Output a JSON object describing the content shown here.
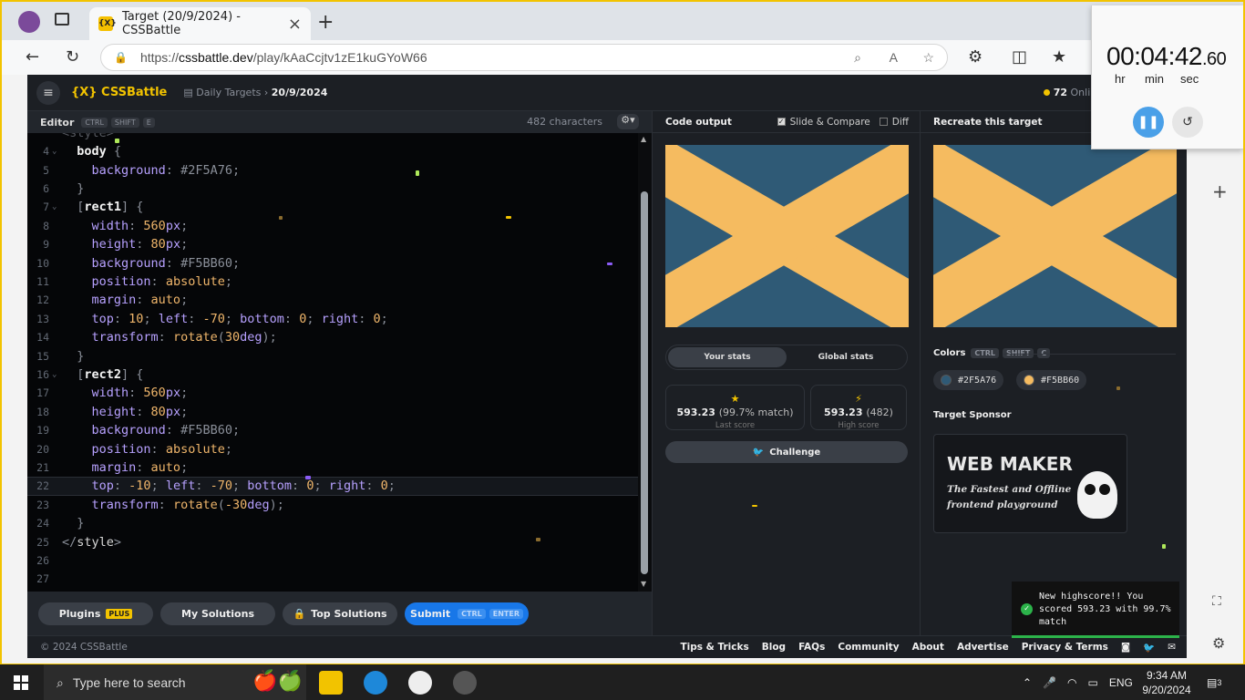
{
  "browser": {
    "tab_title": "Target (20/9/2024) - CSSBattle",
    "url_prefix": "https://",
    "url_host": "cssbattle.dev",
    "url_path": "/play/kAaCcjtv1zE1kuGYoW66"
  },
  "app": {
    "logo": "{X} CSSBattle",
    "breadcrumb_section": "Daily Targets",
    "breadcrumb_current": "20/9/2024",
    "online_count": "72",
    "online_label": "Online"
  },
  "editor": {
    "title": "Editor",
    "shortcut": [
      "CTRL",
      "SHIFT",
      "E"
    ],
    "char_count": "482 characters",
    "lines": [
      {
        "n": "4",
        "fold": true,
        "parts": [
          [
            "sel",
            "  body "
          ],
          [
            "pun",
            "{"
          ]
        ]
      },
      {
        "n": "5",
        "parts": [
          [
            "prop",
            "    background"
          ],
          [
            "pun",
            ": "
          ],
          [
            "pun",
            "#2F5A76"
          ],
          [
            "pun",
            ";"
          ]
        ]
      },
      {
        "n": "6",
        "parts": [
          [
            "pun",
            "  }"
          ]
        ]
      },
      {
        "n": "7",
        "fold": true,
        "parts": [
          [
            "pun",
            "  ["
          ],
          [
            "sel",
            "rect1"
          ],
          [
            "pun",
            "] {"
          ]
        ]
      },
      {
        "n": "8",
        "parts": [
          [
            "prop",
            "    width"
          ],
          [
            "pun",
            ": "
          ],
          [
            "val",
            "560"
          ],
          [
            "prop",
            "px"
          ],
          [
            "pun",
            ";"
          ]
        ]
      },
      {
        "n": "9",
        "parts": [
          [
            "prop",
            "    height"
          ],
          [
            "pun",
            ": "
          ],
          [
            "val",
            "80"
          ],
          [
            "prop",
            "px"
          ],
          [
            "pun",
            ";"
          ]
        ]
      },
      {
        "n": "10",
        "parts": [
          [
            "prop",
            "    background"
          ],
          [
            "pun",
            ": "
          ],
          [
            "pun",
            "#F5BB60"
          ],
          [
            "pun",
            ";"
          ]
        ]
      },
      {
        "n": "11",
        "parts": [
          [
            "prop",
            "    position"
          ],
          [
            "pun",
            ": "
          ],
          [
            "val",
            "absolute"
          ],
          [
            "pun",
            ";"
          ]
        ]
      },
      {
        "n": "12",
        "parts": [
          [
            "prop",
            "    margin"
          ],
          [
            "pun",
            ": "
          ],
          [
            "val",
            "auto"
          ],
          [
            "pun",
            ";"
          ]
        ]
      },
      {
        "n": "13",
        "parts": [
          [
            "prop",
            "    top"
          ],
          [
            "pun",
            ": "
          ],
          [
            "val",
            "10"
          ],
          [
            "pun",
            "; "
          ],
          [
            "prop",
            "left"
          ],
          [
            "pun",
            ": "
          ],
          [
            "val",
            "-70"
          ],
          [
            "pun",
            "; "
          ],
          [
            "prop",
            "bottom"
          ],
          [
            "pun",
            ": "
          ],
          [
            "val",
            "0"
          ],
          [
            "pun",
            "; "
          ],
          [
            "prop",
            "right"
          ],
          [
            "pun",
            ": "
          ],
          [
            "val",
            "0"
          ],
          [
            "pun",
            ";"
          ]
        ]
      },
      {
        "n": "14",
        "parts": [
          [
            "prop",
            "    transform"
          ],
          [
            "pun",
            ": "
          ],
          [
            "val",
            "rotate"
          ],
          [
            "pun",
            "("
          ],
          [
            "val",
            "30"
          ],
          [
            "prop",
            "deg"
          ],
          [
            "pun",
            ");"
          ]
        ]
      },
      {
        "n": "15",
        "parts": [
          [
            "pun",
            "  }"
          ]
        ]
      },
      {
        "n": "16",
        "fold": true,
        "parts": [
          [
            "pun",
            "  ["
          ],
          [
            "sel",
            "rect2"
          ],
          [
            "pun",
            "] {"
          ]
        ]
      },
      {
        "n": "17",
        "parts": [
          [
            "prop",
            "    width"
          ],
          [
            "pun",
            ": "
          ],
          [
            "val",
            "560"
          ],
          [
            "prop",
            "px"
          ],
          [
            "pun",
            ";"
          ]
        ]
      },
      {
        "n": "18",
        "parts": [
          [
            "prop",
            "    height"
          ],
          [
            "pun",
            ": "
          ],
          [
            "val",
            "80"
          ],
          [
            "prop",
            "px"
          ],
          [
            "pun",
            ";"
          ]
        ]
      },
      {
        "n": "19",
        "parts": [
          [
            "prop",
            "    background"
          ],
          [
            "pun",
            ": "
          ],
          [
            "pun",
            "#F5BB60"
          ],
          [
            "pun",
            ";"
          ]
        ]
      },
      {
        "n": "20",
        "parts": [
          [
            "prop",
            "    position"
          ],
          [
            "pun",
            ": "
          ],
          [
            "val",
            "absolute"
          ],
          [
            "pun",
            ";"
          ]
        ]
      },
      {
        "n": "21",
        "parts": [
          [
            "prop",
            "    margin"
          ],
          [
            "pun",
            ": "
          ],
          [
            "val",
            "auto"
          ],
          [
            "pun",
            ";"
          ]
        ]
      },
      {
        "n": "22",
        "active": true,
        "parts": [
          [
            "prop",
            "    top"
          ],
          [
            "pun",
            ": "
          ],
          [
            "val",
            "-10"
          ],
          [
            "pun",
            "; "
          ],
          [
            "prop",
            "left"
          ],
          [
            "pun",
            ": "
          ],
          [
            "val",
            "-70"
          ],
          [
            "pun",
            "; "
          ],
          [
            "prop",
            "bottom"
          ],
          [
            "pun",
            ": "
          ],
          [
            "val",
            "0"
          ],
          [
            "pun",
            "; "
          ],
          [
            "prop",
            "right"
          ],
          [
            "pun",
            ": "
          ],
          [
            "val",
            "0"
          ],
          [
            "pun",
            ";"
          ]
        ]
      },
      {
        "n": "23",
        "parts": [
          [
            "prop",
            "    transform"
          ],
          [
            "pun",
            ": "
          ],
          [
            "val",
            "rotate"
          ],
          [
            "pun",
            "("
          ],
          [
            "val",
            "-30"
          ],
          [
            "prop",
            "deg"
          ],
          [
            "pun",
            ");"
          ]
        ]
      },
      {
        "n": "24",
        "parts": [
          [
            "pun",
            "  }"
          ]
        ]
      },
      {
        "n": "25",
        "parts": [
          [
            "pun",
            "</"
          ],
          [
            "tag",
            "style"
          ],
          [
            "pun",
            ">"
          ]
        ]
      },
      {
        "n": "26",
        "parts": []
      },
      {
        "n": "27",
        "parts": []
      }
    ],
    "buttons": {
      "plugins": "Plugins",
      "plugins_badge": "PLUS",
      "my_solutions": "My Solutions",
      "top_solutions": "Top Solutions",
      "submit": "Submit",
      "submit_kbd": [
        "CTRL",
        "ENTER"
      ]
    }
  },
  "output": {
    "title": "Code output",
    "slide_compare": "Slide & Compare",
    "diff": "Diff",
    "tabs": [
      "Your stats",
      "Global stats"
    ],
    "last_score": "593.23",
    "last_match": "(99.7% match)",
    "last_label": "Last score",
    "high_score": "593.23",
    "high_chars": "(482)",
    "high_label": "High score",
    "challenge": "Challenge"
  },
  "target": {
    "title": "Recreate this target",
    "colors_label": "Colors",
    "colors_kbd": [
      "CTRL",
      "SHIFT",
      "C"
    ],
    "colors": [
      {
        "hex": "#2F5A76"
      },
      {
        "hex": "#F5BB60"
      }
    ],
    "sponsor_label": "Target Sponsor",
    "sponsor_name": "WEB MAKER",
    "sponsor_tag1": "The Fastest and Offline",
    "sponsor_tag2": "frontend playground"
  },
  "footer": {
    "copyright": "© 2024 CSSBattle",
    "links": [
      "Tips & Tricks",
      "Blog",
      "FAQs",
      "Community",
      "About",
      "Advertise",
      "Privacy & Terms"
    ]
  },
  "timer": {
    "main": "00:04:42",
    "fraction": ".60",
    "labels": [
      "hr",
      "min",
      "sec"
    ]
  },
  "toast": {
    "message": "New highscore!! You scored 593.23 with 99.7% match"
  },
  "taskbar": {
    "search_placeholder": "Type here to search",
    "language": "ENG",
    "time": "9:34 AM",
    "date": "9/20/2024",
    "notifications": "3"
  },
  "colors": {
    "bg": "#2F5A76",
    "fg": "#F5BB60",
    "accent": "#F2C300",
    "submit_blue": "#1877E8"
  }
}
